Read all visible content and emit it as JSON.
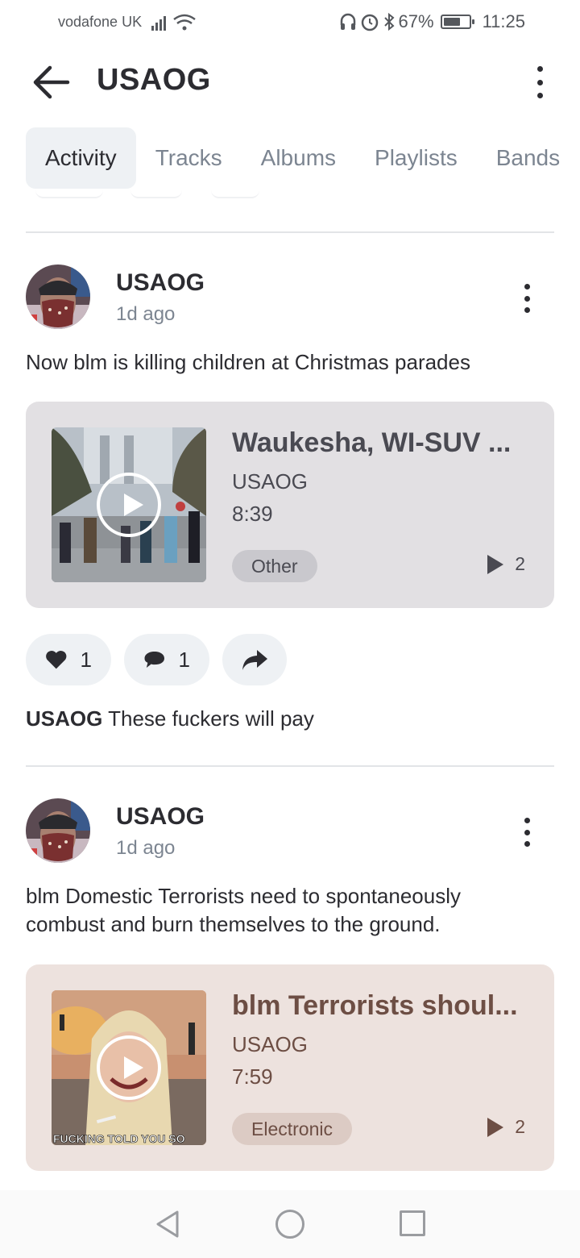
{
  "status": {
    "carrier": "vodafone UK",
    "battery_percent": "67%",
    "battery_level": 0.67,
    "time": "11:25"
  },
  "header": {
    "title": "USAOG"
  },
  "tabs": [
    {
      "label": "Activity",
      "active": true
    },
    {
      "label": "Tracks",
      "active": false
    },
    {
      "label": "Albums",
      "active": false
    },
    {
      "label": "Playlists",
      "active": false
    },
    {
      "label": "Bands",
      "active": false
    }
  ],
  "posts": [
    {
      "author": "USAOG",
      "ago": "1d ago",
      "text": "Now blm is killing children at Christmas parades",
      "card": {
        "title": "Waukesha, WI-SUV ...",
        "artist": "USAOG",
        "duration": "8:39",
        "genre": "Other",
        "plays": "2",
        "bg_color": "#e2e0e3",
        "accent_color": "#4a4a52"
      },
      "likes": "1",
      "comments": "1",
      "caption_author": "USAOG",
      "caption_text": " These fuckers will pay"
    },
    {
      "author": "USAOG",
      "ago": "1d ago",
      "text": "blm Domestic Terrorists need to spontaneously combust and burn themselves to the ground.",
      "card": {
        "title": "blm Terrorists shoul...",
        "artist": "USAOG",
        "duration": "7:59",
        "genre": "Electronic",
        "plays": "2",
        "thumb_caption": "FUCKING TOLD YOU SO",
        "bg_color": "#ede2de",
        "accent_color": "#6d4e44"
      }
    }
  ]
}
